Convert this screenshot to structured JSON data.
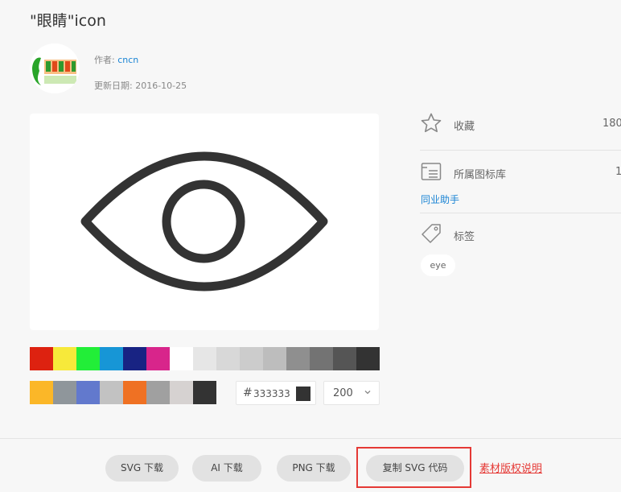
{
  "header": {
    "title": "\"眼睛\"icon"
  },
  "meta": {
    "author_label": "作者:",
    "author_name": "cncn",
    "updated_label": "更新日期:",
    "updated_date": "2016-10-25"
  },
  "preview": {
    "icon": "eye-icon",
    "stroke_color": "#333333"
  },
  "palette": {
    "row1": [
      "#dd2210",
      "#f7e93a",
      "#22ee38",
      "#1796d6",
      "#182383",
      "#d8258b",
      "#ffffff",
      "#e6e6e6",
      "#d8d8d8",
      "#cccccc",
      "#bdbdbd",
      "#8f8f8f",
      "#737373",
      "#555555",
      "#333333"
    ],
    "row2": [
      "#fbb728",
      "#8f969b",
      "#6279cd",
      "#c2c2c2",
      "#ef7123",
      "#a0a0a0",
      "#d6d2d1",
      "#333333"
    ]
  },
  "color_input": {
    "hash": "#",
    "value": "333333",
    "chip_color": "#333333"
  },
  "size_select": {
    "value": "200"
  },
  "sidebar": {
    "favorite_label": "收藏",
    "favorite_count": "180",
    "library_label": "所属图标库",
    "library_count": "1",
    "library_link": "同业助手",
    "tags_label": "标签",
    "tags": [
      "eye"
    ]
  },
  "actions": {
    "svg_download": "SVG 下载",
    "ai_download": "AI 下载",
    "png_download": "PNG 下载",
    "copy_svg": "复制 SVG 代码",
    "copyright": "素材版权说明"
  },
  "colors": {
    "accent_link": "#1a84d4",
    "highlight": "#e53935"
  }
}
